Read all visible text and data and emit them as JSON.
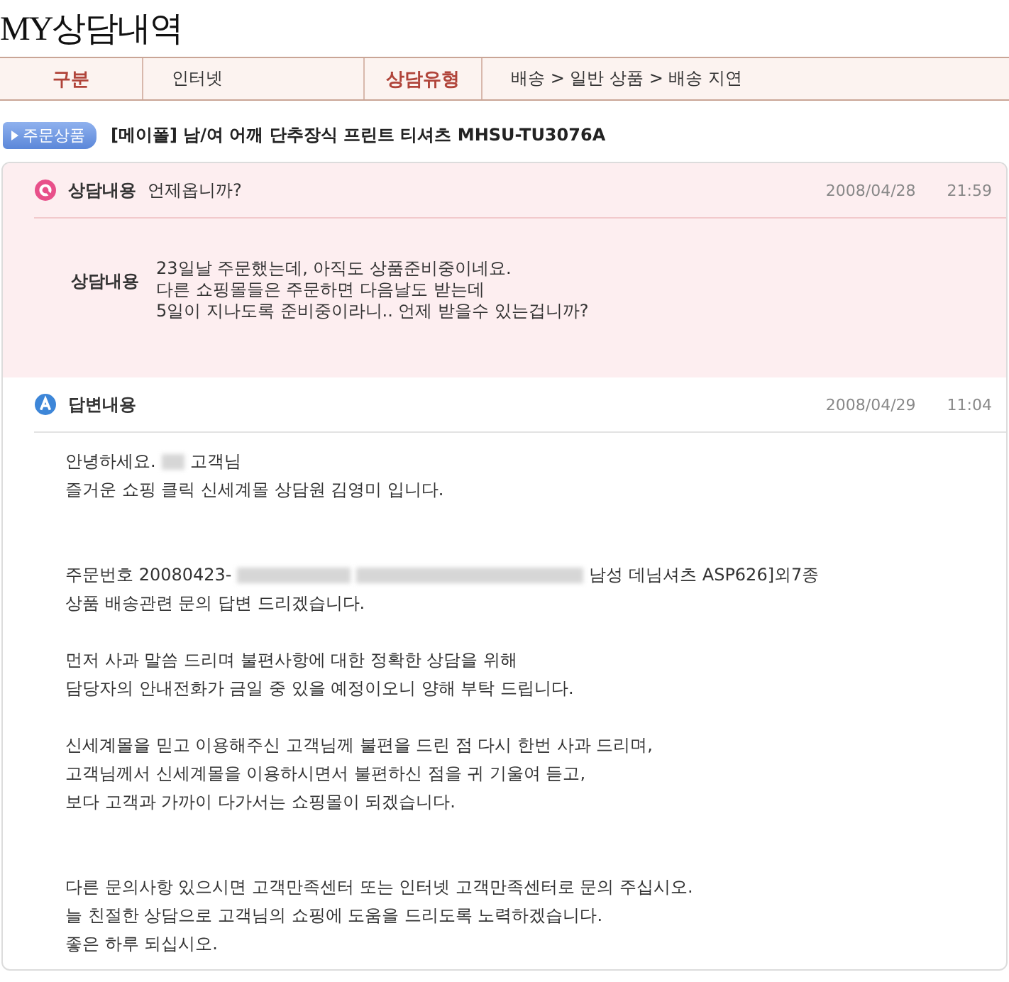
{
  "page_title": "MY상담내역",
  "info_bar": [
    {
      "label": "구분",
      "value": "인터넷"
    },
    {
      "label": "상담유형",
      "value": "배송 > 일반 상품 > 배송 지연"
    }
  ],
  "product": {
    "badge": "주문상품",
    "name": "[메이폴] 남/여 어깨 단추장식 프린트 티셔츠 MHSU-TU3076A"
  },
  "question": {
    "label": "상담내용",
    "subject": "언제옵니까?",
    "date": "2008/04/28",
    "time": "21:59",
    "body_label": "상담내용",
    "body_lines": [
      "23일날 주문했는데, 아직도 상품준비중이네요.",
      "다른 쇼핑몰들은 주문하면 다음날도 받는데",
      "5일이 지나도록 준비중이라니.. 언제 받을수 있는겁니까?"
    ]
  },
  "answer": {
    "label": "답변내용",
    "date": "2008/04/29",
    "time": "11:04",
    "paragraphs": [
      {
        "wide_gap": false,
        "lines": [
          [
            {
              "kind": "text",
              "text": "안녕하세요."
            },
            {
              "kind": "blur_word"
            },
            {
              "kind": "text",
              "text": "고객님"
            }
          ],
          [
            {
              "kind": "text",
              "text": "즐거운 쇼핑 클릭 신세계몰 상담원 김영미 입니다."
            }
          ]
        ]
      },
      {
        "wide_gap": true,
        "lines": [
          [
            {
              "kind": "text",
              "text": "주문번호 20080423-"
            },
            {
              "kind": "blur_phrase"
            },
            {
              "kind": "blur_line"
            },
            {
              "kind": "text",
              "text": "남성 데님셔츠 ASP626]외7종"
            }
          ],
          [
            {
              "kind": "text",
              "text": "상품 배송관련 문의 답변 드리겠습니다."
            }
          ]
        ]
      },
      {
        "wide_gap": false,
        "lines": [
          [
            {
              "kind": "text",
              "text": "먼저 사과 말씀 드리며 불편사항에 대한 정확한 상담을 위해"
            }
          ],
          [
            {
              "kind": "text",
              "text": "담당자의 안내전화가 금일 중 있을 예정이오니 양해 부탁 드립니다."
            }
          ]
        ]
      },
      {
        "wide_gap": false,
        "lines": [
          [
            {
              "kind": "text",
              "text": "신세계몰을 믿고 이용해주신 고객님께 불편을 드린 점 다시 한번 사과 드리며,"
            }
          ],
          [
            {
              "kind": "text",
              "text": "고객님께서 신세계몰을 이용하시면서 불편하신 점을 귀 기울여 듣고,"
            }
          ],
          [
            {
              "kind": "text",
              "text": "보다 고객과 가까이 다가서는 쇼핑몰이 되겠습니다."
            }
          ]
        ]
      },
      {
        "wide_gap": true,
        "lines": [
          [
            {
              "kind": "text",
              "text": "다른 문의사항 있으시면 고객만족센터 또는 인터넷 고객만족센터로 문의 주십시오."
            }
          ],
          [
            {
              "kind": "text",
              "text": "늘 친절한 상담으로 고객님의 쇼핑에 도움을 드리도록 노력하겠습니다."
            }
          ],
          [
            {
              "kind": "text",
              "text": "좋은 하루 되십시오."
            }
          ]
        ]
      }
    ]
  }
}
